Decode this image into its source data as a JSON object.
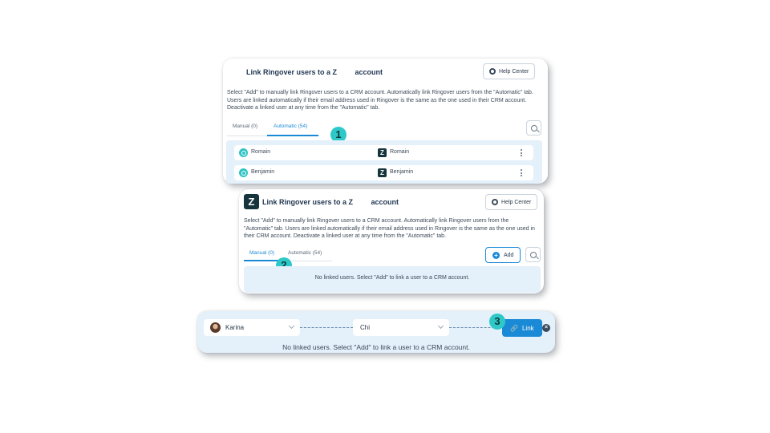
{
  "panel1": {
    "title": "Link Ringover users to a Z         account",
    "help": "Help Center",
    "description": "Select \"Add\" to manually link Ringover users to a CRM account. Automatically link Ringover users from the \"Automatic\" tab. Users are linked automatically if their email address used in Ringover is the same as the one used in their CRM account. Deactivate a linked user at any time from the \"Automatic\" tab.",
    "tabs": [
      "Manual (0)",
      "Automatic (54)"
    ],
    "active_tab": "Automatic (54)",
    "badge": "1",
    "rows": [
      {
        "ringover": "Romain",
        "crm": "Romain"
      },
      {
        "ringover": "Benjamin",
        "crm": "Benjamin"
      }
    ]
  },
  "panel2": {
    "logo_letter": "Z",
    "title": "Link Ringover users to a Z         account",
    "help": "Help Center",
    "description": "Select \"Add\" to manually link Ringover users to a CRM account. Automatically link Ringover users from the \"Automatic\" tab. Users are linked automatically if their email address used in Ringover is the same as the one used in their CRM account. Deactivate a linked user at any time from the \"Automatic\" tab.",
    "tabs": [
      "Manual (0)",
      "Automatic (54)"
    ],
    "active_tab": "Manual (0)",
    "badge": "2",
    "add_label": "Add",
    "empty": "No linked users. Select \"Add\" to link a user to a CRM account."
  },
  "panel3": {
    "badge": "3",
    "ringover_user": "Karina",
    "crm_user": "Chi",
    "link_label": "Link",
    "empty": "No linked users. Select \"Add\" to link a user to a CRM account."
  },
  "colors": {
    "accent": "#1a8ad6",
    "badge": "#2ec8c8",
    "panel_bg": "#e4f0fa"
  }
}
